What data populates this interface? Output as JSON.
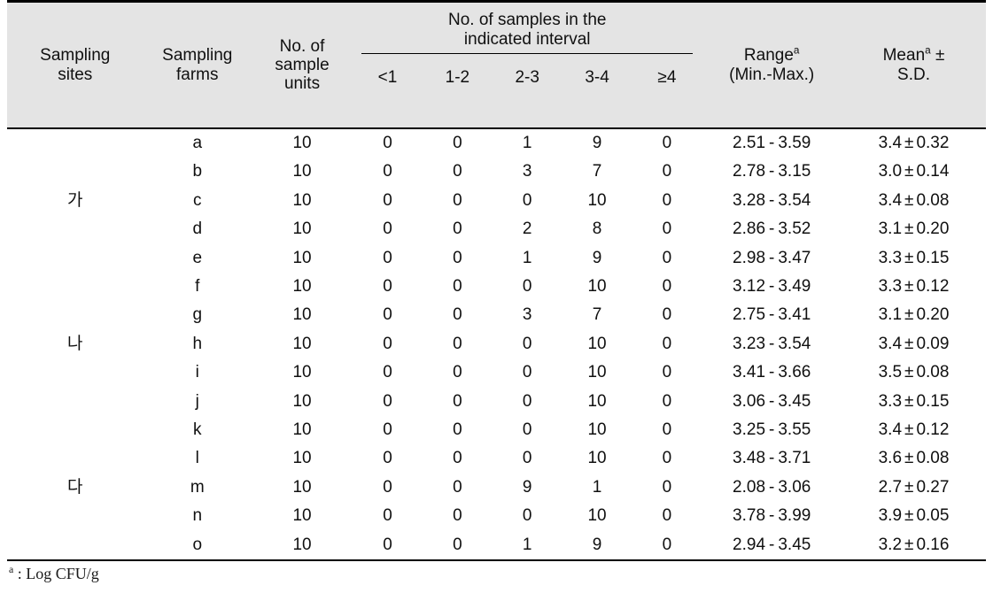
{
  "table": {
    "columns": {
      "site": "Sampling\nsites",
      "site_line1": "Sampling",
      "site_line2": "sites",
      "farm_line1": "Sampling",
      "farm_line2": "farms",
      "units_line1": "No. of",
      "units_line2": "sample",
      "units_line3": "units",
      "group_line1": "No. of samples in the",
      "group_line2": "indicated interval",
      "interval_headers": [
        "<1",
        "1-2",
        "2-3",
        "3-4",
        "≥4"
      ],
      "range_line1": "Range",
      "range_sup": "a",
      "range_line2": "(Min.-Max.)",
      "mean_line1": "Mean",
      "mean_sup": "a",
      "mean_pm": "±",
      "mean_line2": "S.D."
    },
    "rows": [
      {
        "site": "",
        "farm": "a",
        "units": "10",
        "i1": "0",
        "i2": "0",
        "i3": "1",
        "i4": "9",
        "i5": "0",
        "range_min": "2.51",
        "range_dash": "-",
        "range_max": "3.59",
        "mean": "3.4",
        "pm": "±",
        "sd": "0.32"
      },
      {
        "site": "",
        "farm": "b",
        "units": "10",
        "i1": "0",
        "i2": "0",
        "i3": "3",
        "i4": "7",
        "i5": "0",
        "range_min": "2.78",
        "range_dash": "-",
        "range_max": "3.15",
        "mean": "3.0",
        "pm": "±",
        "sd": "0.14"
      },
      {
        "site": "가",
        "farm": "c",
        "units": "10",
        "i1": "0",
        "i2": "0",
        "i3": "0",
        "i4": "10",
        "i5": "0",
        "range_min": "3.28",
        "range_dash": "-",
        "range_max": "3.54",
        "mean": "3.4",
        "pm": "±",
        "sd": "0.08"
      },
      {
        "site": "",
        "farm": "d",
        "units": "10",
        "i1": "0",
        "i2": "0",
        "i3": "2",
        "i4": "8",
        "i5": "0",
        "range_min": "2.86",
        "range_dash": "-",
        "range_max": "3.52",
        "mean": "3.1",
        "pm": "±",
        "sd": "0.20"
      },
      {
        "site": "",
        "farm": "e",
        "units": "10",
        "i1": "0",
        "i2": "0",
        "i3": "1",
        "i4": "9",
        "i5": "0",
        "range_min": "2.98",
        "range_dash": "-",
        "range_max": "3.47",
        "mean": "3.3",
        "pm": "±",
        "sd": "0.15"
      },
      {
        "site": "",
        "farm": "f",
        "units": "10",
        "i1": "0",
        "i2": "0",
        "i3": "0",
        "i4": "10",
        "i5": "0",
        "range_min": "3.12",
        "range_dash": "-",
        "range_max": "3.49",
        "mean": "3.3",
        "pm": "±",
        "sd": "0.12"
      },
      {
        "site": "",
        "farm": "g",
        "units": "10",
        "i1": "0",
        "i2": "0",
        "i3": "3",
        "i4": "7",
        "i5": "0",
        "range_min": "2.75",
        "range_dash": "-",
        "range_max": "3.41",
        "mean": "3.1",
        "pm": "±",
        "sd": "0.20"
      },
      {
        "site": "나",
        "farm": "h",
        "units": "10",
        "i1": "0",
        "i2": "0",
        "i3": "0",
        "i4": "10",
        "i5": "0",
        "range_min": "3.23",
        "range_dash": "-",
        "range_max": "3.54",
        "mean": "3.4",
        "pm": "±",
        "sd": "0.09"
      },
      {
        "site": "",
        "farm": "i",
        "units": "10",
        "i1": "0",
        "i2": "0",
        "i3": "0",
        "i4": "10",
        "i5": "0",
        "range_min": "3.41",
        "range_dash": "-",
        "range_max": "3.66",
        "mean": "3.5",
        "pm": "±",
        "sd": "0.08"
      },
      {
        "site": "",
        "farm": "j",
        "units": "10",
        "i1": "0",
        "i2": "0",
        "i3": "0",
        "i4": "10",
        "i5": "0",
        "range_min": "3.06",
        "range_dash": "-",
        "range_max": "3.45",
        "mean": "3.3",
        "pm": "±",
        "sd": "0.15"
      },
      {
        "site": "",
        "farm": "k",
        "units": "10",
        "i1": "0",
        "i2": "0",
        "i3": "0",
        "i4": "10",
        "i5": "0",
        "range_min": "3.25",
        "range_dash": "-",
        "range_max": "3.55",
        "mean": "3.4",
        "pm": "±",
        "sd": "0.12"
      },
      {
        "site": "",
        "farm": "l",
        "units": "10",
        "i1": "0",
        "i2": "0",
        "i3": "0",
        "i4": "10",
        "i5": "0",
        "range_min": "3.48",
        "range_dash": "-",
        "range_max": "3.71",
        "mean": "3.6",
        "pm": "±",
        "sd": "0.08"
      },
      {
        "site": "다",
        "farm": "m",
        "units": "10",
        "i1": "0",
        "i2": "0",
        "i3": "9",
        "i4": "1",
        "i5": "0",
        "range_min": "2.08",
        "range_dash": "-",
        "range_max": "3.06",
        "mean": "2.7",
        "pm": "±",
        "sd": "0.27"
      },
      {
        "site": "",
        "farm": "n",
        "units": "10",
        "i1": "0",
        "i2": "0",
        "i3": "0",
        "i4": "10",
        "i5": "0",
        "range_min": "3.78",
        "range_dash": "-",
        "range_max": "3.99",
        "mean": "3.9",
        "pm": "±",
        "sd": "0.05"
      },
      {
        "site": "",
        "farm": "o",
        "units": "10",
        "i1": "0",
        "i2": "0",
        "i3": "1",
        "i4": "9",
        "i5": "0",
        "range_min": "2.94",
        "range_dash": "-",
        "range_max": "3.45",
        "mean": "3.2",
        "pm": "±",
        "sd": "0.16"
      }
    ],
    "footnote_sup": "a",
    "footnote_text": " :  Log  CFU/g"
  },
  "colors": {
    "header_bg": "#e4e4e4",
    "rule": "#000000",
    "text": "#101010"
  }
}
